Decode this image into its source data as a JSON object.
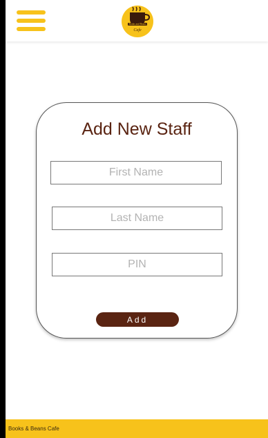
{
  "header": {
    "menu_icon": "hamburger-menu-icon",
    "logo_icon": "coffee-cup-logo",
    "logo_text_line1": "Books and Beans",
    "logo_text_line2": "Cafe"
  },
  "form": {
    "title": "Add New Staff",
    "first_name": {
      "placeholder": "First Name",
      "value": ""
    },
    "last_name": {
      "placeholder": "Last Name",
      "value": ""
    },
    "pin": {
      "placeholder": "PIN",
      "value": ""
    },
    "add_label": "Add"
  },
  "footer": {
    "text": "Books & Beans Cafe"
  },
  "colors": {
    "accent": "#f7c21b",
    "brand_brown": "#5a2412"
  }
}
